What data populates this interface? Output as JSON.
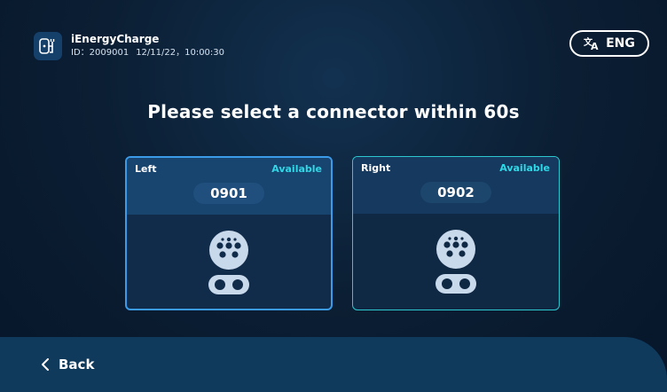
{
  "header": {
    "app_name": "iEnergyCharge",
    "device_id": "ID：2009001",
    "datetime": "12/11/22，10:00:30",
    "logo_icon": "plug-phone-icon",
    "language_button": {
      "label": "ENG",
      "icon": "translate-icon"
    }
  },
  "main": {
    "title": "Please select a connector within 60s",
    "connectors": [
      {
        "name": "Left",
        "status": "Available",
        "number": "0901",
        "icon": "type2-connector-icon",
        "selected": true,
        "border_color": "#3b9be8"
      },
      {
        "name": "Right",
        "status": "Available",
        "number": "0902",
        "icon": "type2-connector-icon",
        "selected": false,
        "border_color": "#2cc7cf"
      }
    ]
  },
  "footer": {
    "back_label": "Back",
    "back_icon": "chevron-left-icon"
  },
  "colors": {
    "background": "#0b1e33",
    "accent_status": "#2fd8e6",
    "bottom_bar": "#0f3a5c"
  }
}
